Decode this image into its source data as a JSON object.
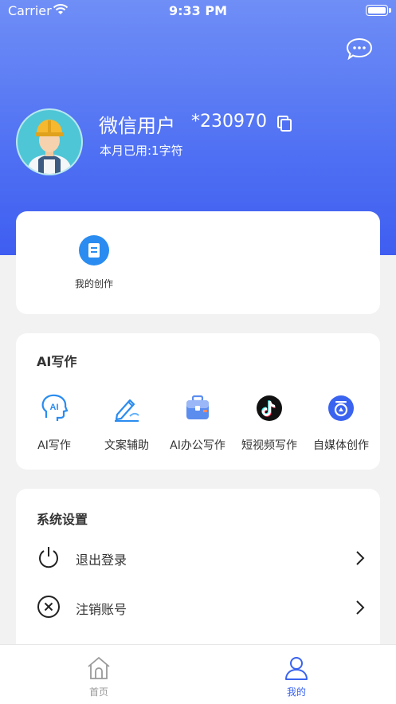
{
  "status_bar": {
    "carrier": "Carrier",
    "time": "9:33 PM"
  },
  "profile": {
    "name": "微信用户",
    "id": "*230970",
    "usage": "本月已用:1字符"
  },
  "quick": {
    "my_creations": "我的创作"
  },
  "ai_writing": {
    "title": "AI写作",
    "tools": [
      {
        "label": "AI写作",
        "icon": "ai-head-icon"
      },
      {
        "label": "文案辅助",
        "icon": "pen-icon"
      },
      {
        "label": "AI办公写作",
        "icon": "briefcase-icon"
      },
      {
        "label": "短视频写作",
        "icon": "tiktok-icon"
      },
      {
        "label": "自媒体创作",
        "icon": "media-icon"
      }
    ]
  },
  "settings": {
    "title": "系统设置",
    "items": [
      {
        "label": "退出登录",
        "icon": "power-icon"
      },
      {
        "label": "注销账号",
        "icon": "close-circle-icon"
      }
    ]
  },
  "tabbar": {
    "home": "首页",
    "mine": "我的",
    "active_color": "#3a63f0",
    "inactive_color": "#999999"
  },
  "colors": {
    "brand": "#4f70f3",
    "accent_blue": "#2a8cf0"
  }
}
